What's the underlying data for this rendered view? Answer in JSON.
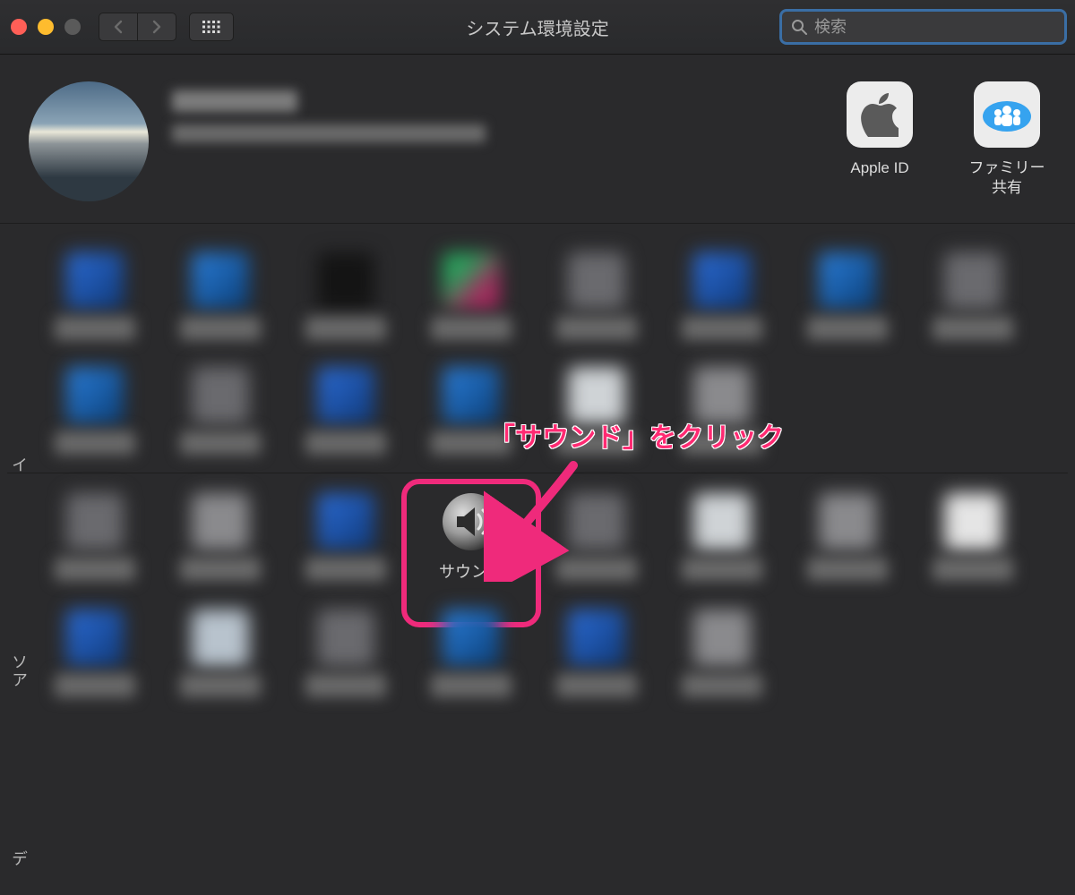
{
  "window": {
    "title": "システム環境設定"
  },
  "search": {
    "placeholder": "検索"
  },
  "header": {
    "apple_id_label": "Apple ID",
    "family_sharing_label": "ファミリー\n共有"
  },
  "section_labels": {
    "s1": "イ",
    "s2": "ソア",
    "s3": "デ"
  },
  "prefs": {
    "sound_label": "サウンド"
  },
  "annotation": {
    "text": "「サウンド」をクリック"
  }
}
